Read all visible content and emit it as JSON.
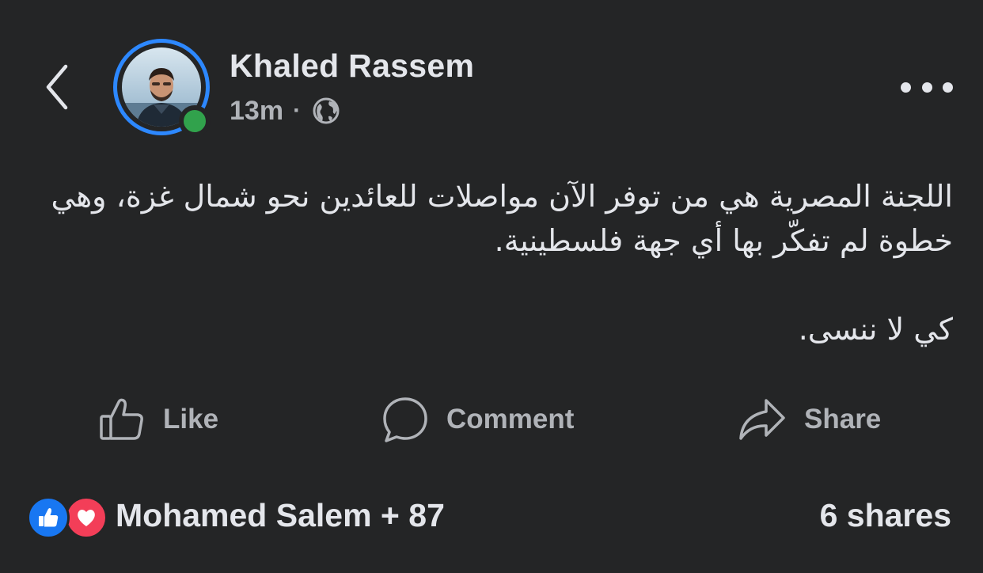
{
  "header": {
    "back_icon": "chevron-left-icon",
    "author_name": "Khaled Rassem",
    "timestamp": "13m",
    "separator": "·",
    "privacy_icon": "globe-icon",
    "more_icon": "more-horizontal-icon",
    "online_status_color": "#31a24c",
    "story_ring_color": "#2d88ff"
  },
  "post": {
    "paragraph_1": "اللجنة المصرية هي من توفر الآن مواصلات للعائدين نحو شمال غزة، وهي خطوة لم تفكّر بها أي جهة فلسطينية.",
    "paragraph_2": "كي لا ننسى."
  },
  "actions": {
    "like_label": "Like",
    "like_icon": "thumbs-up-icon",
    "comment_label": "Comment",
    "comment_icon": "comment-bubble-icon",
    "share_label": "Share",
    "share_icon": "share-arrow-icon"
  },
  "footer": {
    "reaction_icons": [
      "like-reaction-icon",
      "love-reaction-icon"
    ],
    "reactions_summary": "Mohamed Salem + 87",
    "shares": "6 shares"
  },
  "colors": {
    "background": "#242526",
    "primary_text": "#e4e6eb",
    "secondary_text": "#b0b3b8",
    "like_blue": "#1877f2",
    "love_red": "#f33e58"
  }
}
